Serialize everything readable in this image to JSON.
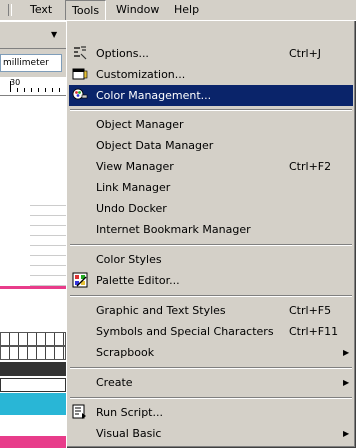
{
  "menubar": {
    "text_label": "Text",
    "tools_label": "Tools",
    "window_label": "Window",
    "help_label": "Help"
  },
  "units": {
    "value": "millimeter"
  },
  "ruler": {
    "label": "30"
  },
  "tools_menu": {
    "options": {
      "label": "Options...",
      "shortcut": "Ctrl+J"
    },
    "customization": {
      "label": "Customization..."
    },
    "color_management": {
      "label": "Color Management..."
    },
    "object_manager": {
      "label": "Object Manager"
    },
    "object_data_manager": {
      "label": "Object Data Manager"
    },
    "view_manager": {
      "label": "View Manager",
      "shortcut": "Ctrl+F2"
    },
    "link_manager": {
      "label": "Link Manager"
    },
    "undo_docker": {
      "label": "Undo Docker"
    },
    "internet_bookmark_manager": {
      "label": "Internet Bookmark Manager"
    },
    "color_styles": {
      "label": "Color Styles"
    },
    "palette_editor": {
      "label": "Palette Editor..."
    },
    "graphic_text_styles": {
      "label": "Graphic and Text Styles",
      "shortcut": "Ctrl+F5"
    },
    "symbols_special": {
      "label": "Symbols and Special Characters",
      "shortcut": "Ctrl+F11"
    },
    "scrapbook": {
      "label": "Scrapbook"
    },
    "create": {
      "label": "Create"
    },
    "run_script": {
      "label": "Run Script..."
    },
    "visual_basic": {
      "label": "Visual Basic"
    }
  },
  "colors": {
    "menu_bg": "#d4d0c8",
    "highlight_bg": "#0a246a",
    "highlight_text": "#ffffff"
  },
  "icons": {
    "options": "options-icon",
    "customization": "customization-icon",
    "color_management": "color-management-icon",
    "palette_editor": "palette-editor-icon",
    "run_script": "run-script-icon"
  }
}
